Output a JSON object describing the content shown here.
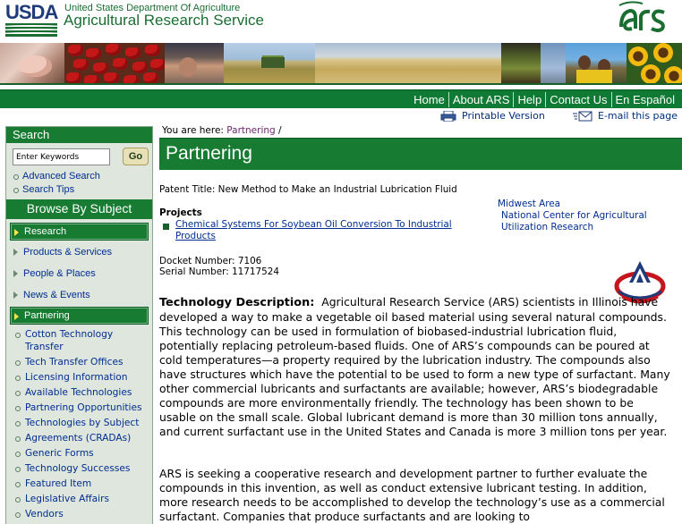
{
  "header": {
    "usda_logo_text": "USDA",
    "department": "United States Department Of Agriculture",
    "agency": "Agricultural Research Service",
    "ars_logo": "ars-logo-icon"
  },
  "nav": {
    "items": [
      "Home",
      "About ARS",
      "Help",
      "Contact Us",
      "En Español"
    ]
  },
  "utility": {
    "printable": "Printable Version",
    "email": "E-mail this page"
  },
  "sidebar": {
    "search_title": "Search",
    "search_placeholder": "Enter Keywords",
    "go_label": "Go",
    "search_links": [
      "Advanced Search",
      "Search Tips"
    ],
    "browse_title": "Browse By Subject",
    "categories": [
      "Research",
      "Products & Services",
      "People & Places",
      "News & Events",
      "Partnering"
    ],
    "partnering_items": [
      "Cotton Technology Transfer",
      "Tech Transfer Offices",
      "Licensing Information",
      "Available Technologies",
      "Partnering Opportunities",
      "Technologies by Subject",
      "Agreements (CRADAs)",
      "Generic Forms",
      "Technology Successes",
      "Featured Item",
      "Legislative Affairs",
      "Vendors"
    ]
  },
  "breadcrumb": {
    "prefix": "You are here:",
    "link": "Partnering",
    "separator": "/"
  },
  "main": {
    "title": "Partnering",
    "patent_title": "Patent Title: New Method to Make an Industrial Lubrication Fluid",
    "projects_heading": "Projects",
    "project_link": "Chemical Systems For Soybean Oil Conversion To Industrial Products",
    "area": "Midwest Area",
    "center": "National Center for Agricultural Utilization Research",
    "docket": "Docket Number: 7106",
    "serial": "Serial Number: 11717524",
    "tech_desc_label": "Technology Description:",
    "tech_desc": "Agricultural Research Service (ARS) scientists in Illinois have developed a way to make a vegetable oil based material using several natural compounds.  This technology can be used in formulation of biobased-industrial lubrication fluid, potentially replacing petroleum-based fluids.  One of ARS’s compounds can be poured at cold temperatures—a property required by the lubrication industry.  The compounds also have structures which have the potential to be used to form a new type of surfactant.  Many other commercial lubricants and surfactants are available; however, ARS’s biodegradable compounds are more environmentally friendly.  The technology has been shown to be usable on the small scale.  Global lubricant demand is more than 30 million tons annually, and current surfactant use in the United States and Canada is more 3 million tons per year.",
    "partner_text": "ARS is seeking a cooperative research and development partner to further evaluate the compounds in this invention, as well as conduct extensive lubricant testing.  In addition, more research needs to be accomplished to develop the technology’s use as a commercial surfactant.  Companies that produce surfactants and are looking to"
  },
  "colors": {
    "brand_green": "#177b32",
    "link_blue": "#002d91",
    "sidebar_bg": "#dfe6dd"
  }
}
